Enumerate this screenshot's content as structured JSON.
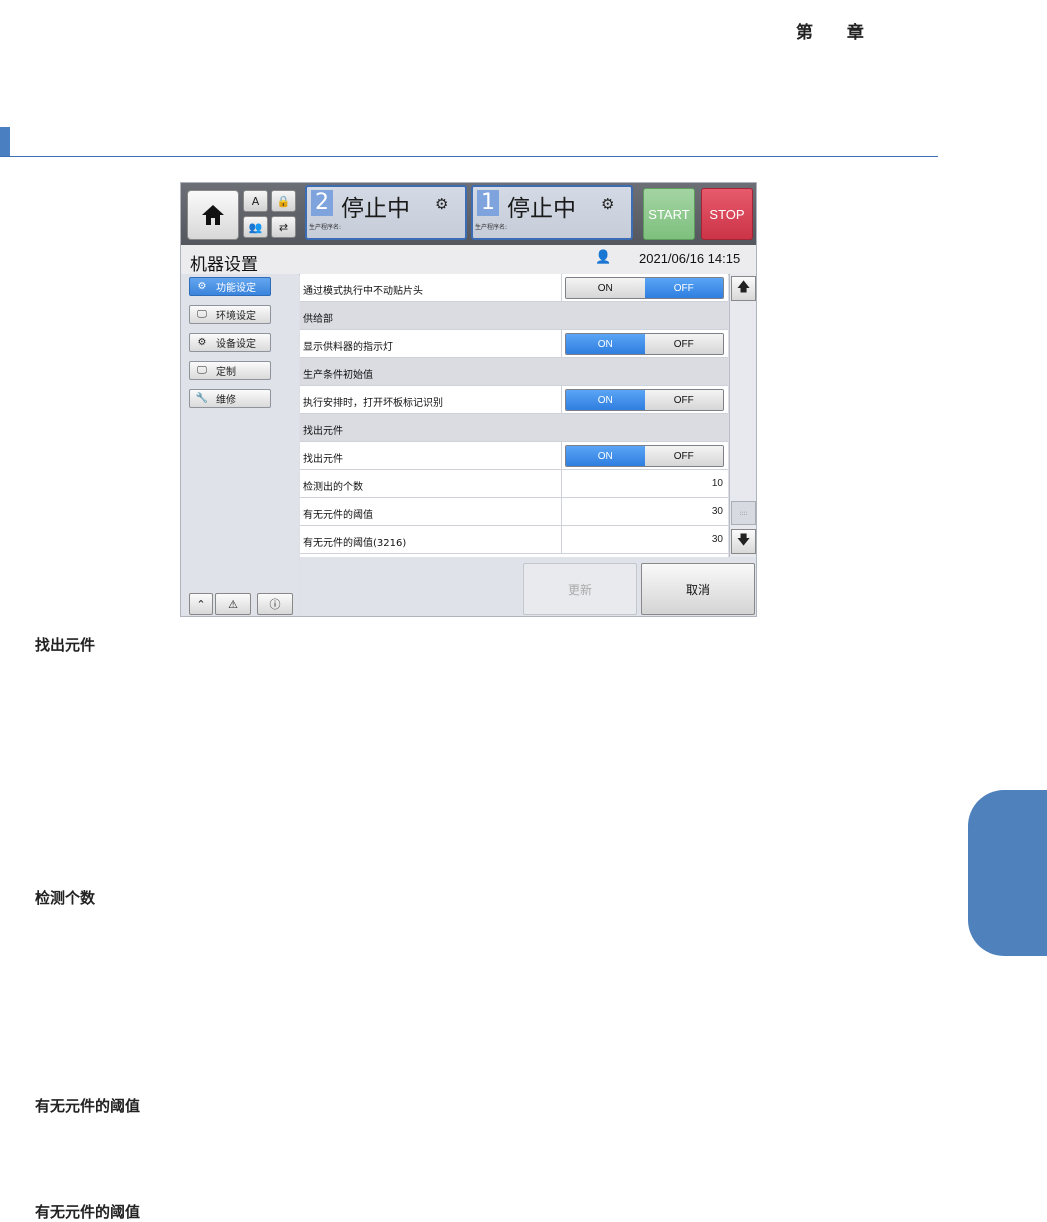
{
  "page": {
    "chapter_label": "第 章",
    "headings": [
      "找出元件",
      "检测个数",
      "有无元件的阈值",
      "有无元件的阈值"
    ]
  },
  "ui": {
    "topbar": {
      "home_icon": "home-icon",
      "mini_buttons": [
        "A",
        "🔒",
        "👥",
        "⇄"
      ],
      "lanes": [
        {
          "number": "2",
          "status": "停止中",
          "program_label": "生产程序名:"
        },
        {
          "number": "1",
          "status": "停止中",
          "program_label": "生产程序名:"
        }
      ],
      "start_label": "START",
      "stop_label": "STOP"
    },
    "titlebar": {
      "title": "机器设置",
      "datetime": "2021/06/16 14:15"
    },
    "sidebar": {
      "items": [
        {
          "label": "功能设定",
          "icon": "⚙",
          "active": true
        },
        {
          "label": "环境设定",
          "icon": "🖵",
          "active": false
        },
        {
          "label": "设备设定",
          "icon": "⚙",
          "active": false
        },
        {
          "label": "定制",
          "icon": "🖵",
          "active": false
        },
        {
          "label": "维修",
          "icon": "🔧",
          "active": false
        }
      ],
      "bottom_buttons": [
        "⌃",
        "⚠",
        "ⓘ"
      ]
    },
    "rows": [
      {
        "label": "通过模式执行中不动贴片头",
        "type": "toggle",
        "on": "ON",
        "off": "OFF",
        "state": "OFF"
      },
      {
        "label": "供给部",
        "type": "section"
      },
      {
        "label": "显示供料器的指示灯",
        "type": "toggle",
        "on": "ON",
        "off": "OFF",
        "state": "ON"
      },
      {
        "label": "生产条件初始值",
        "type": "section"
      },
      {
        "label": "执行安排时，打开坏板标记识别",
        "type": "toggle",
        "on": "ON",
        "off": "OFF",
        "state": "ON"
      },
      {
        "label": "找出元件",
        "type": "section"
      },
      {
        "label": "找出元件",
        "type": "toggle",
        "on": "ON",
        "off": "OFF",
        "state": "ON"
      },
      {
        "label": "检测出的个数",
        "type": "value",
        "value": "10"
      },
      {
        "label": "有无元件的阈值",
        "type": "value",
        "value": "30"
      },
      {
        "label": "有无元件的阈值(3216)",
        "type": "value",
        "value": "30"
      }
    ],
    "footer": {
      "update_label": "更新",
      "cancel_label": "取消"
    }
  }
}
